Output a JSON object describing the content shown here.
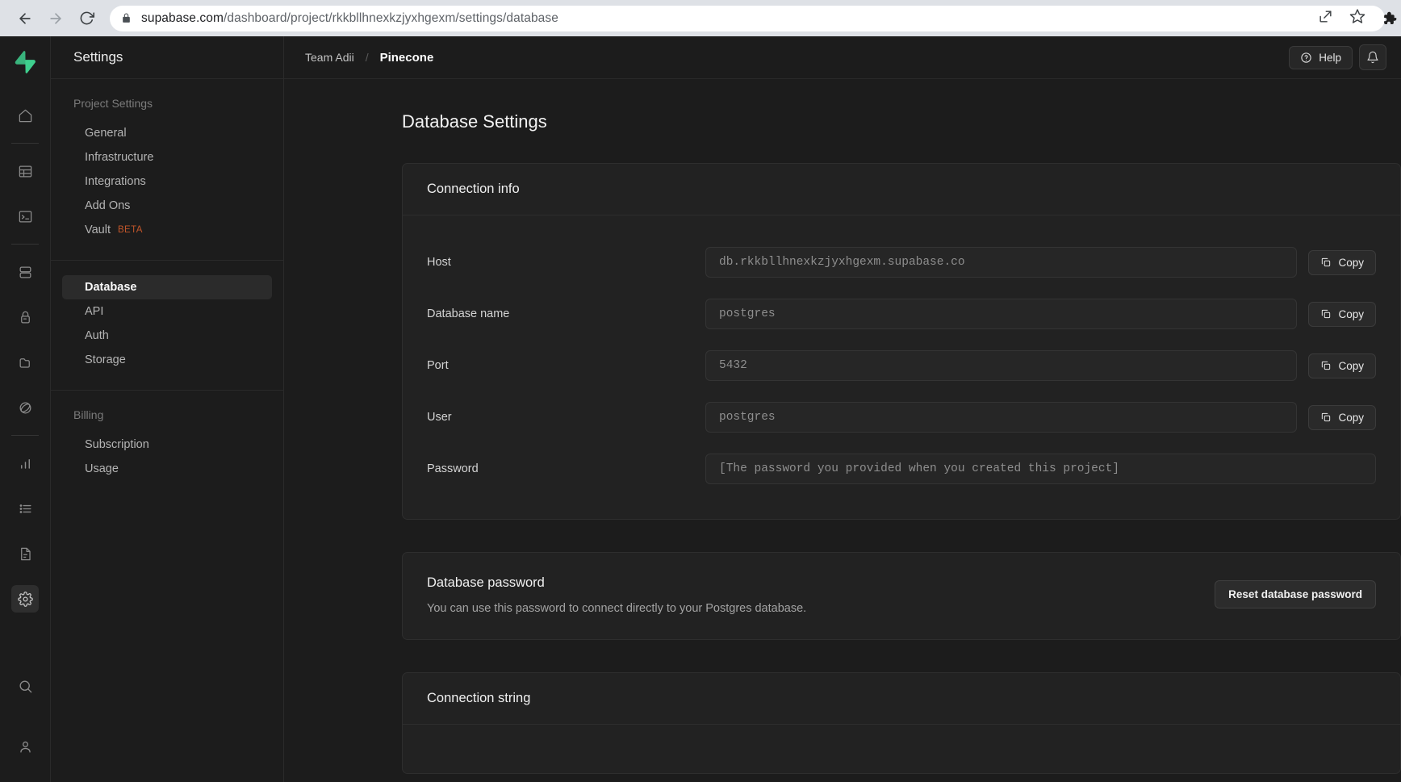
{
  "browser": {
    "url_host": "supabase.com",
    "url_path": "/dashboard/project/rkkbllhnexkzjyxhgexm/settings/database",
    "back_icon": "back-arrow-icon",
    "forward_icon": "forward-arrow-icon",
    "reload_icon": "reload-icon",
    "lock_icon": "lock-icon",
    "share_icon": "share-icon",
    "bookmark_icon": "star-icon",
    "extensions_icon": "puzzle-piece-icon"
  },
  "rail": {
    "logo": "supabase-logo",
    "logo_color": "#3ecf8e",
    "items": [
      {
        "name": "home-icon"
      },
      {
        "name": "table-editor-icon"
      },
      {
        "name": "sql-editor-icon"
      },
      {
        "name": "database-icon"
      },
      {
        "name": "auth-lock-icon"
      },
      {
        "name": "storage-icon"
      },
      {
        "name": "edge-functions-icon"
      },
      {
        "name": "reports-icon"
      },
      {
        "name": "logs-icon"
      },
      {
        "name": "api-docs-icon"
      },
      {
        "name": "settings-gear-icon"
      }
    ],
    "bottom_items": [
      {
        "name": "search-icon"
      },
      {
        "name": "account-icon"
      }
    ]
  },
  "navpanel": {
    "title": "Settings",
    "groups": [
      {
        "label": "Project Settings",
        "items": [
          {
            "label": "General",
            "active": false
          },
          {
            "label": "Infrastructure",
            "active": false
          },
          {
            "label": "Integrations",
            "active": false
          },
          {
            "label": "Add Ons",
            "active": false
          },
          {
            "label": "Vault",
            "active": false,
            "badge": "BETA"
          }
        ]
      },
      {
        "label": "",
        "items": [
          {
            "label": "Database",
            "active": true
          },
          {
            "label": "API",
            "active": false
          },
          {
            "label": "Auth",
            "active": false
          },
          {
            "label": "Storage",
            "active": false
          }
        ]
      },
      {
        "label": "Billing",
        "items": [
          {
            "label": "Subscription",
            "active": false
          },
          {
            "label": "Usage",
            "active": false
          }
        ]
      }
    ]
  },
  "topbar": {
    "breadcrumb_org": "Team Adii",
    "breadcrumb_sep": "/",
    "breadcrumb_project": "Pinecone",
    "help_label": "Help",
    "help_icon": "question-circle-icon",
    "notifications_icon": "bell-icon"
  },
  "page": {
    "title": "Database Settings",
    "connection_info": {
      "heading": "Connection info",
      "copy_label": "Copy",
      "copy_icon": "copy-icon",
      "rows": [
        {
          "label": "Host",
          "value": "db.rkkbllhnexkzjyxhgexm.supabase.co",
          "has_copy": true
        },
        {
          "label": "Database name",
          "value": "postgres",
          "has_copy": true
        },
        {
          "label": "Port",
          "value": "5432",
          "has_copy": true
        },
        {
          "label": "User",
          "value": "postgres",
          "has_copy": true
        },
        {
          "label": "Password",
          "value": "[The password you provided when you created this project]",
          "has_copy": false
        }
      ]
    },
    "database_password": {
      "heading": "Database password",
      "description": "You can use this password to connect directly to your Postgres database.",
      "reset_label": "Reset database password"
    },
    "connection_string": {
      "heading": "Connection string"
    }
  }
}
